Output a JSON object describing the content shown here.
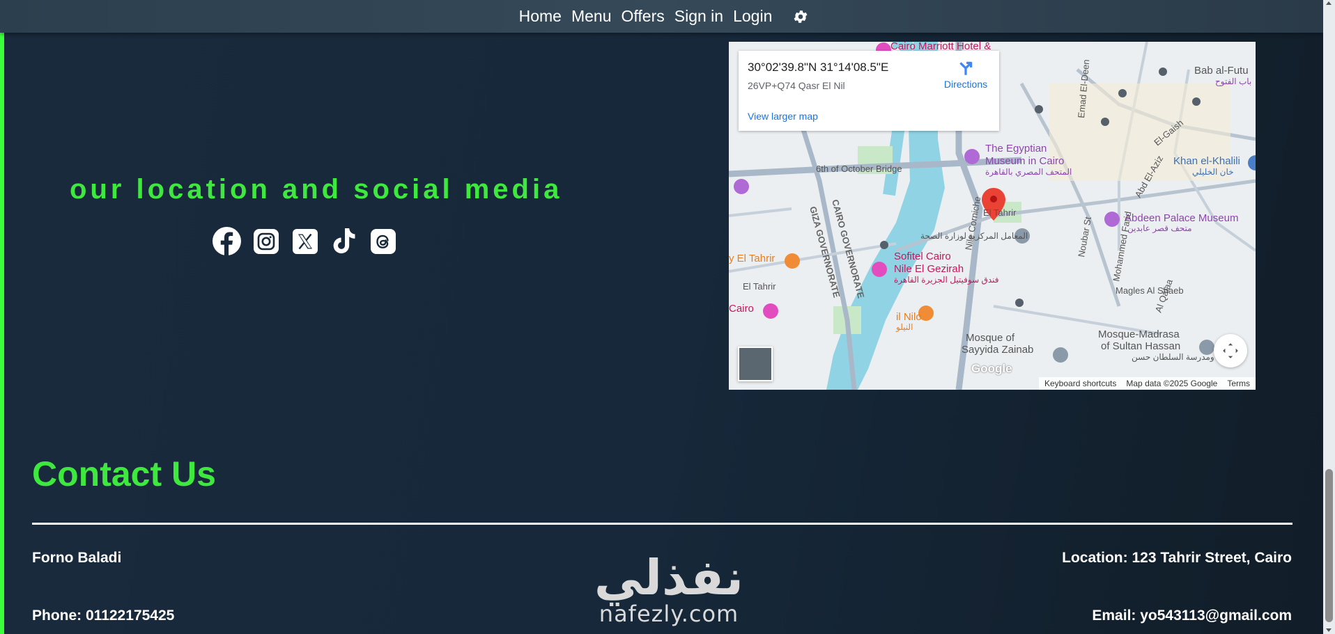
{
  "nav": {
    "items": [
      "Home",
      "Menu",
      "Offers",
      "Sign in",
      "Login"
    ],
    "settings_icon": "gear-icon"
  },
  "location": {
    "title": "our location and social media",
    "social_icons": [
      "facebook-icon",
      "instagram-icon",
      "x-icon",
      "tiktok-icon",
      "threads-icon"
    ]
  },
  "map": {
    "coordinates": "30°02'39.8\"N 31°14'08.5\"E",
    "plus_code": "26VP+Q74 Qasr El Nil",
    "directions_label": "Directions",
    "larger_map_label": "View larger map",
    "google_label": "Google",
    "footer": {
      "shortcuts": "Keyboard shortcuts",
      "map_data": "Map data ©2025 Google",
      "terms": "Terms"
    },
    "labels": {
      "marriott": "Cairo Marriott Hotel &",
      "bab": "Bab al-Futu",
      "bab_ar": "باب الفتوح",
      "museum": "The Egyptian",
      "museum2": "Museum in Cairo",
      "museum_ar": "المتحف المصري بالقاهرة",
      "khan": "Khan el-Khalili",
      "khan_ar": "خان الخليلي",
      "abdeen": "Abdeen Palace Museum",
      "abdeen_ar": "متحف قصر عابدين",
      "sofitel": "Sofitel Cairo",
      "sofitel2": "Nile El Gezirah",
      "sofitel_ar": "فندق سوفيتيل الجزيرة القاهرة",
      "nilo": "il Nilo",
      "nilo_ar": "النيلو",
      "mosque": "Mosque of",
      "mosque2": "Sayyida Zainab",
      "sultan": "Mosque-Madrasa",
      "sultan2": "of Sultan Hassan",
      "sultan_ar": "مسجد ومدرسة السلطان حسن",
      "tahrir_w": "y El Tahrir",
      "tahrir_w2": "El Tahrir",
      "cairo_w": "Cairo",
      "october": "6th of October Bridge",
      "giza": "GIZA GOVERNORATE",
      "cairo_gov": "CAIRO GOVERNORATE",
      "el_tahrir": "El Tahrir",
      "nouba": "Noubar St",
      "mfarid": "Mohammed Farid",
      "emad": "Emad El-Deen",
      "magles": "Magles Al Shaeb",
      "qalaa": "Al Qalaa",
      "azziz": "Abd El-Aziz",
      "geish": "El-Gaish",
      "corniche": "Nile Corniche",
      "corniche2": "rniche",
      "ministry_ar": "المعامل المركزية لوزارة الصحة"
    }
  },
  "contact": {
    "title": "Contact Us",
    "name": "Forno Baladi",
    "phone": "Phone: 01122175425",
    "location": "Location: 123 Tahrir Street, Cairo",
    "email": "Email: yo543113@gmail.com"
  },
  "watermark": {
    "arabic": "نفذلي",
    "latin": "nafezly.com"
  },
  "colors": {
    "accent": "#3ee83e",
    "bg": "#16283a",
    "nav_bg": "#354959"
  }
}
